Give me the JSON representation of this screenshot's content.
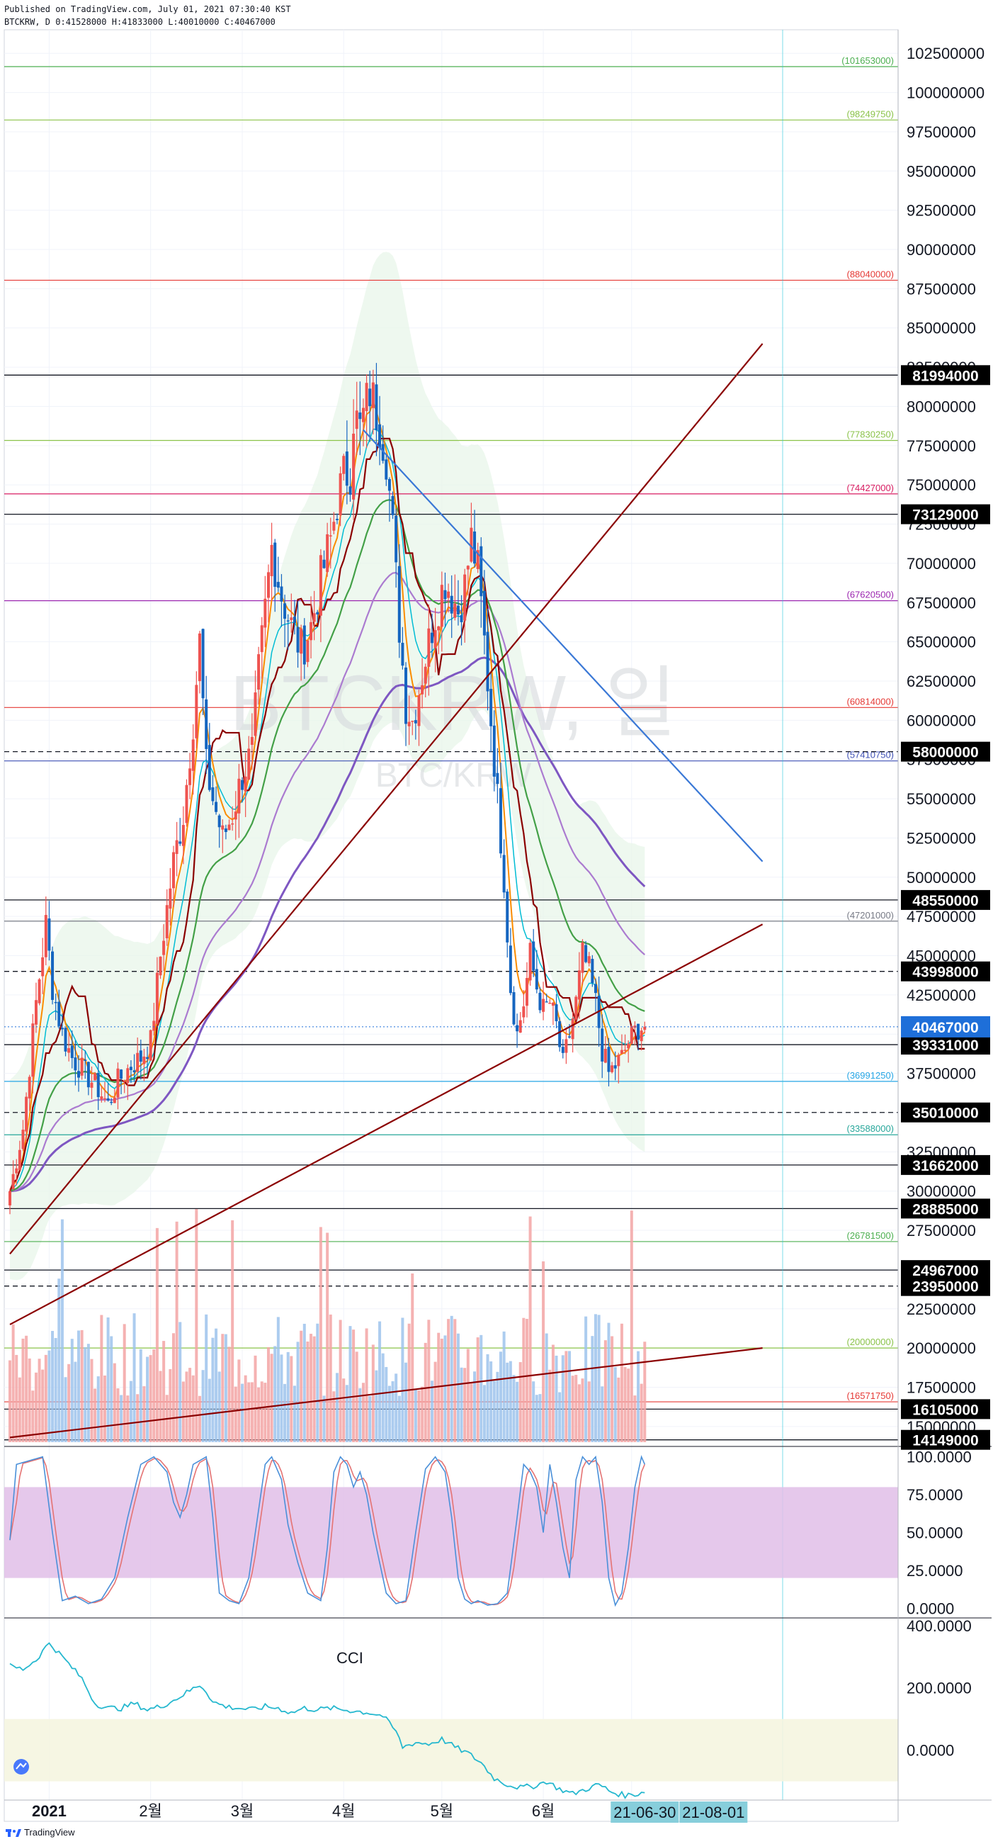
{
  "header": {
    "published": "Published on TradingView.com, July 01, 2021 07:30:40 KST",
    "ohlc": "BTCKRW, D 0:41528000 H:41833000 L:40010000 C:40467000"
  },
  "watermark": {
    "symbol": "BTCKRW, 일",
    "pair": "BTC/KRW"
  },
  "footer": {
    "brand": "TradingView"
  },
  "colors": {
    "up": "#ef5350",
    "down": "#1565c0",
    "cloud": "#e8f5e9",
    "stoch_band": "#e1bee7",
    "cci_band": "#f5f5e0"
  },
  "chart_data": [
    {
      "type": "candlestick",
      "symbol": "BTCKRW",
      "timeframe": "D",
      "ylim": [
        14000000,
        104000000
      ],
      "y_ticks": [
        15000000,
        17500000,
        20000000,
        22500000,
        25000000,
        27500000,
        30000000,
        32500000,
        35000000,
        37500000,
        40000000,
        42500000,
        45000000,
        47500000,
        50000000,
        52500000,
        55000000,
        57500000,
        60000000,
        62500000,
        65000000,
        67500000,
        70000000,
        72500000,
        75000000,
        77500000,
        80000000,
        82500000,
        85000000,
        87500000,
        90000000,
        92500000,
        95000000,
        97500000,
        100000000,
        102500000
      ],
      "y_tick_labels": [
        "15000000",
        "17500000",
        "20000000",
        "22500000",
        "25000000",
        "27500000",
        "30000000",
        "32500000",
        "35000000",
        "37500000",
        "40000000",
        "42500000",
        "45000000",
        "47500000",
        "50000000",
        "52500000",
        "55000000",
        "57500000",
        "60000000",
        "62500000",
        "65000000",
        "67500000",
        "70000000",
        "72500000",
        "75000000",
        "77500000",
        "80000000",
        "82500000",
        "85000000",
        "87500000",
        "90000000",
        "92500000",
        "95000000",
        "97500000",
        "100000000",
        "102500000"
      ],
      "x_labels": [
        {
          "day": 12,
          "label": "2021"
        },
        {
          "day": 43,
          "label": "2월"
        },
        {
          "day": 71,
          "label": "3월"
        },
        {
          "day": 102,
          "label": "4월"
        },
        {
          "day": 132,
          "label": "5월"
        },
        {
          "day": 163,
          "label": "6월"
        },
        {
          "day": 190,
          "label": "7"
        }
      ],
      "x_tags": [
        {
          "day": 194,
          "label": "21-06-30"
        },
        {
          "day": 215,
          "label": "21-08-01"
        }
      ],
      "anchors": [
        [
          0,
          30000000
        ],
        [
          4,
          34000000
        ],
        [
          8,
          42000000
        ],
        [
          11,
          47000000
        ],
        [
          13,
          43000000
        ],
        [
          16,
          40000000
        ],
        [
          19,
          38500000
        ],
        [
          23,
          37500000
        ],
        [
          27,
          36500000
        ],
        [
          30,
          35500000
        ],
        [
          33,
          37000000
        ],
        [
          37,
          38000000
        ],
        [
          40,
          38500000
        ],
        [
          43,
          39500000
        ],
        [
          46,
          45000000
        ],
        [
          50,
          51000000
        ],
        [
          53,
          54000000
        ],
        [
          56,
          60000000
        ],
        [
          58,
          65000000
        ],
        [
          60,
          57000000
        ],
        [
          62,
          55000000
        ],
        [
          65,
          52500000
        ],
        [
          68,
          54000000
        ],
        [
          71,
          56500000
        ],
        [
          74,
          58000000
        ],
        [
          76,
          63000000
        ],
        [
          78,
          67000000
        ],
        [
          80,
          71000000
        ],
        [
          83,
          68000000
        ],
        [
          86,
          66000000
        ],
        [
          89,
          64500000
        ],
        [
          92,
          66000000
        ],
        [
          95,
          69000000
        ],
        [
          98,
          71500000
        ],
        [
          100,
          74000000
        ],
        [
          102,
          75500000
        ],
        [
          104,
          76000000
        ],
        [
          105,
          79500000
        ],
        [
          107,
          78500000
        ],
        [
          110,
          81000000
        ],
        [
          113,
          79000000
        ],
        [
          115,
          77000000
        ],
        [
          117,
          72000000
        ],
        [
          119,
          66000000
        ],
        [
          121,
          61000000
        ],
        [
          123,
          60000000
        ],
        [
          125,
          62000000
        ],
        [
          127,
          64000000
        ],
        [
          129,
          66000000
        ],
        [
          131,
          67500000
        ],
        [
          133,
          69000000
        ],
        [
          135,
          68000000
        ],
        [
          137,
          67000000
        ],
        [
          139,
          68500000
        ],
        [
          141,
          71500000
        ],
        [
          143,
          69500000
        ],
        [
          145,
          65000000
        ],
        [
          147,
          60000000
        ],
        [
          149,
          55000000
        ],
        [
          151,
          50000000
        ],
        [
          153,
          43000000
        ],
        [
          155,
          40000000
        ],
        [
          157,
          42000000
        ],
        [
          159,
          45000000
        ],
        [
          161,
          43000000
        ],
        [
          163,
          41500000
        ],
        [
          165,
          42000000
        ],
        [
          167,
          40500000
        ],
        [
          169,
          38000000
        ],
        [
          171,
          40000000
        ],
        [
          173,
          42000000
        ],
        [
          175,
          45000000
        ],
        [
          177,
          44000000
        ],
        [
          179,
          42000000
        ],
        [
          181,
          39000000
        ],
        [
          183,
          37500000
        ],
        [
          185,
          38000000
        ],
        [
          187,
          38500000
        ],
        [
          189,
          39500000
        ],
        [
          192,
          40467000
        ]
      ],
      "last_price": 40467000,
      "horizontal_levels": [
        {
          "price": 101653000,
          "label": "(101653000)",
          "color": "#4caf50"
        },
        {
          "price": 98249750,
          "label": "(98249750)",
          "color": "#8bc34a"
        },
        {
          "price": 88040000,
          "label": "(88040000)",
          "color": "#e53935"
        },
        {
          "price": 77830250,
          "label": "(77830250)",
          "color": "#8bc34a"
        },
        {
          "price": 74427000,
          "label": "(74427000)",
          "color": "#d81b60"
        },
        {
          "price": 67620500,
          "label": "(67620500)",
          "color": "#9c27b0"
        },
        {
          "price": 60814000,
          "label": "(60814000)",
          "color": "#e53935"
        },
        {
          "price": 57410750,
          "label": "(57410750)",
          "color": "#3f51b5"
        },
        {
          "price": 47201000,
          "label": "(47201000)",
          "color": "#787b86"
        },
        {
          "price": 36991250,
          "label": "(36991250)",
          "color": "#26a6e5"
        },
        {
          "price": 33588000,
          "label": "(33588000)",
          "color": "#26a69a"
        },
        {
          "price": 26781500,
          "label": "(26781500)",
          "color": "#4caf50"
        },
        {
          "price": 20000000,
          "label": "(20000000)",
          "color": "#8bc34a"
        },
        {
          "price": 16571750,
          "label": "(16571750)",
          "color": "#e53935"
        }
      ],
      "support_resistance": [
        {
          "price": 81994000,
          "label": "81994000",
          "dashed": false
        },
        {
          "price": 73129000,
          "label": "73129000",
          "dashed": false
        },
        {
          "price": 58000000,
          "label": "58000000",
          "dashed": true
        },
        {
          "price": 48550000,
          "label": "48550000",
          "dashed": false
        },
        {
          "price": 43998000,
          "label": "43998000",
          "dashed": true
        },
        {
          "price": 39331000,
          "label": "39331000",
          "dashed": false
        },
        {
          "price": 35010000,
          "label": "35010000",
          "dashed": true
        },
        {
          "price": 31662000,
          "label": "31662000",
          "dashed": false
        },
        {
          "price": 28885000,
          "label": "28885000",
          "dashed": false
        },
        {
          "price": 24967000,
          "label": "24967000",
          "dashed": false
        },
        {
          "price": 23950000,
          "label": "23950000",
          "dashed": true
        },
        {
          "price": 16105000,
          "label": "16105000",
          "dashed": false
        },
        {
          "price": 14149000,
          "label": "14149000",
          "dashed": false
        }
      ],
      "trendlines": [
        {
          "from": [
            108,
            78500000
          ],
          "to": [
            230,
            51000000
          ],
          "color": "#3a78d6"
        },
        {
          "from": [
            0,
            26000000
          ],
          "to": [
            230,
            84000000
          ],
          "color": "#8b0000"
        },
        {
          "from": [
            0,
            21500000
          ],
          "to": [
            230,
            47000000
          ],
          "color": "#8b0000"
        },
        {
          "from": [
            0,
            14300000
          ],
          "to": [
            230,
            20000000
          ],
          "color": "#8b0000"
        }
      ],
      "volume_scale_max": 1
    },
    {
      "type": "line",
      "indicator": "Stochastic",
      "ylim": [
        -5,
        105
      ],
      "y_ticks": [
        0,
        25,
        50,
        75,
        100
      ],
      "y_tick_labels": [
        "0.0000",
        "25.0000",
        "50.0000",
        "75.0000",
        "100.0000"
      ],
      "band": [
        20,
        80
      ],
      "k_anchors": [
        [
          0,
          45
        ],
        [
          2,
          95
        ],
        [
          10,
          100
        ],
        [
          13,
          50
        ],
        [
          16,
          5
        ],
        [
          20,
          8
        ],
        [
          24,
          3
        ],
        [
          28,
          6
        ],
        [
          32,
          20
        ],
        [
          36,
          60
        ],
        [
          40,
          95
        ],
        [
          44,
          100
        ],
        [
          48,
          90
        ],
        [
          50,
          70
        ],
        [
          52,
          60
        ],
        [
          54,
          75
        ],
        [
          56,
          95
        ],
        [
          60,
          100
        ],
        [
          62,
          60
        ],
        [
          64,
          10
        ],
        [
          67,
          5
        ],
        [
          70,
          3
        ],
        [
          73,
          20
        ],
        [
          76,
          65
        ],
        [
          78,
          95
        ],
        [
          80,
          100
        ],
        [
          83,
          85
        ],
        [
          85,
          55
        ],
        [
          88,
          30
        ],
        [
          91,
          10
        ],
        [
          95,
          5
        ],
        [
          97,
          40
        ],
        [
          99,
          90
        ],
        [
          101,
          100
        ],
        [
          103,
          95
        ],
        [
          105,
          80
        ],
        [
          107,
          90
        ],
        [
          109,
          75
        ],
        [
          111,
          50
        ],
        [
          113,
          30
        ],
        [
          115,
          10
        ],
        [
          118,
          3
        ],
        [
          121,
          5
        ],
        [
          124,
          50
        ],
        [
          127,
          92
        ],
        [
          130,
          100
        ],
        [
          133,
          90
        ],
        [
          135,
          60
        ],
        [
          137,
          20
        ],
        [
          139,
          6
        ],
        [
          141,
          3
        ],
        [
          143,
          5
        ],
        [
          146,
          2
        ],
        [
          149,
          3
        ],
        [
          152,
          10
        ],
        [
          155,
          60
        ],
        [
          157,
          95
        ],
        [
          159,
          90
        ],
        [
          161,
          80
        ],
        [
          163,
          50
        ],
        [
          165,
          95
        ],
        [
          167,
          70
        ],
        [
          169,
          40
        ],
        [
          171,
          20
        ],
        [
          173,
          85
        ],
        [
          175,
          100
        ],
        [
          177,
          95
        ],
        [
          179,
          100
        ],
        [
          181,
          70
        ],
        [
          183,
          20
        ],
        [
          185,
          2
        ],
        [
          187,
          10
        ],
        [
          189,
          40
        ],
        [
          191,
          80
        ],
        [
          193,
          100
        ],
        [
          194,
          95
        ]
      ],
      "d_lag": 2
    },
    {
      "type": "line",
      "indicator": "CCI",
      "label": "CCI",
      "ylim": [
        -160,
        420
      ],
      "y_ticks": [
        0,
        200,
        400
      ],
      "y_tick_labels": [
        "0.0000",
        "200.0000",
        "400.0000"
      ],
      "band": [
        -100,
        100
      ],
      "anchors": [
        [
          0,
          270
        ],
        [
          4,
          260
        ],
        [
          8,
          290
        ],
        [
          12,
          345
        ],
        [
          16,
          300
        ],
        [
          22,
          230
        ],
        [
          26,
          150
        ],
        [
          30,
          135
        ],
        [
          34,
          135
        ],
        [
          38,
          150
        ],
        [
          42,
          130
        ],
        [
          46,
          140
        ],
        [
          50,
          160
        ],
        [
          54,
          185
        ],
        [
          58,
          210
        ],
        [
          60,
          190
        ],
        [
          62,
          155
        ],
        [
          66,
          140
        ],
        [
          70,
          135
        ],
        [
          74,
          130
        ],
        [
          78,
          140
        ],
        [
          82,
          135
        ],
        [
          86,
          120
        ],
        [
          90,
          135
        ],
        [
          94,
          130
        ],
        [
          98,
          135
        ],
        [
          102,
          130
        ],
        [
          106,
          125
        ],
        [
          110,
          120
        ],
        [
          114,
          110
        ],
        [
          118,
          60
        ],
        [
          120,
          10
        ],
        [
          124,
          25
        ],
        [
          128,
          20
        ],
        [
          132,
          35
        ],
        [
          136,
          10
        ],
        [
          140,
          -10
        ],
        [
          144,
          -40
        ],
        [
          148,
          -90
        ],
        [
          152,
          -110
        ],
        [
          156,
          -120
        ],
        [
          160,
          -115
        ],
        [
          164,
          -100
        ],
        [
          168,
          -125
        ],
        [
          172,
          -140
        ],
        [
          176,
          -125
        ],
        [
          180,
          -110
        ],
        [
          184,
          -135
        ],
        [
          188,
          -145
        ],
        [
          192,
          -140
        ],
        [
          194,
          -130
        ]
      ]
    }
  ]
}
